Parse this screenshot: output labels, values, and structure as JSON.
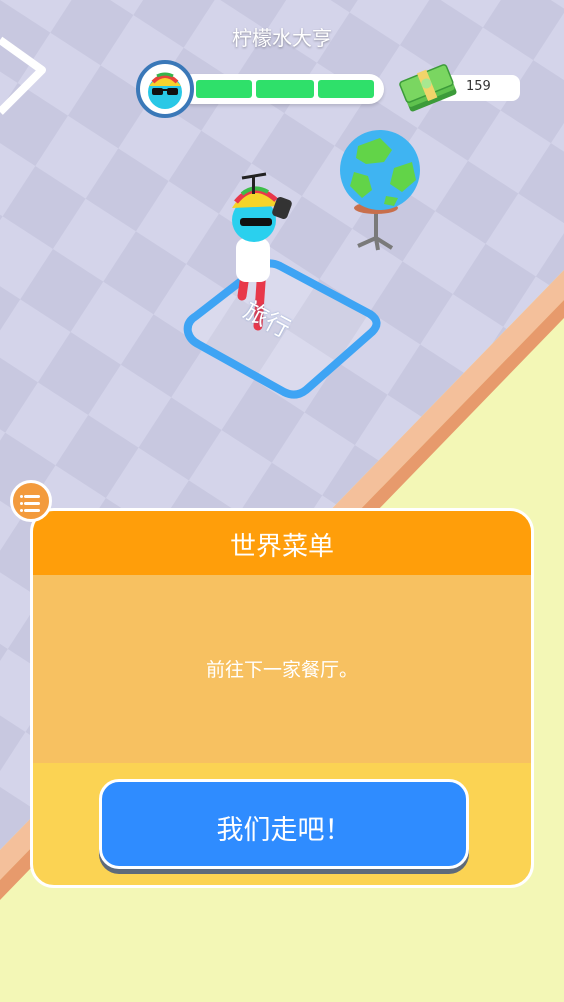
{
  "hud": {
    "title": "柠檬水大亨",
    "cash": "159",
    "progress_segments": 3
  },
  "scene": {
    "zone_label": "旅行"
  },
  "dialog": {
    "title": "世界菜单",
    "message": "前往下一家餐厅。",
    "button_label": "我们走吧！"
  },
  "icons": {
    "menu": "menu-list-icon",
    "cash": "cash-stack-icon",
    "avatar": "player-avatar-icon",
    "globe": "globe-icon"
  },
  "colors": {
    "header_orange": "#ff9e0a",
    "body_orange": "#f7c161",
    "panel_yellow": "#fbd353",
    "button_blue": "#2f8cff",
    "progress_green": "#2fe06a",
    "floor_light": "#d7d7ea",
    "floor_dark": "#c9c9df"
  }
}
